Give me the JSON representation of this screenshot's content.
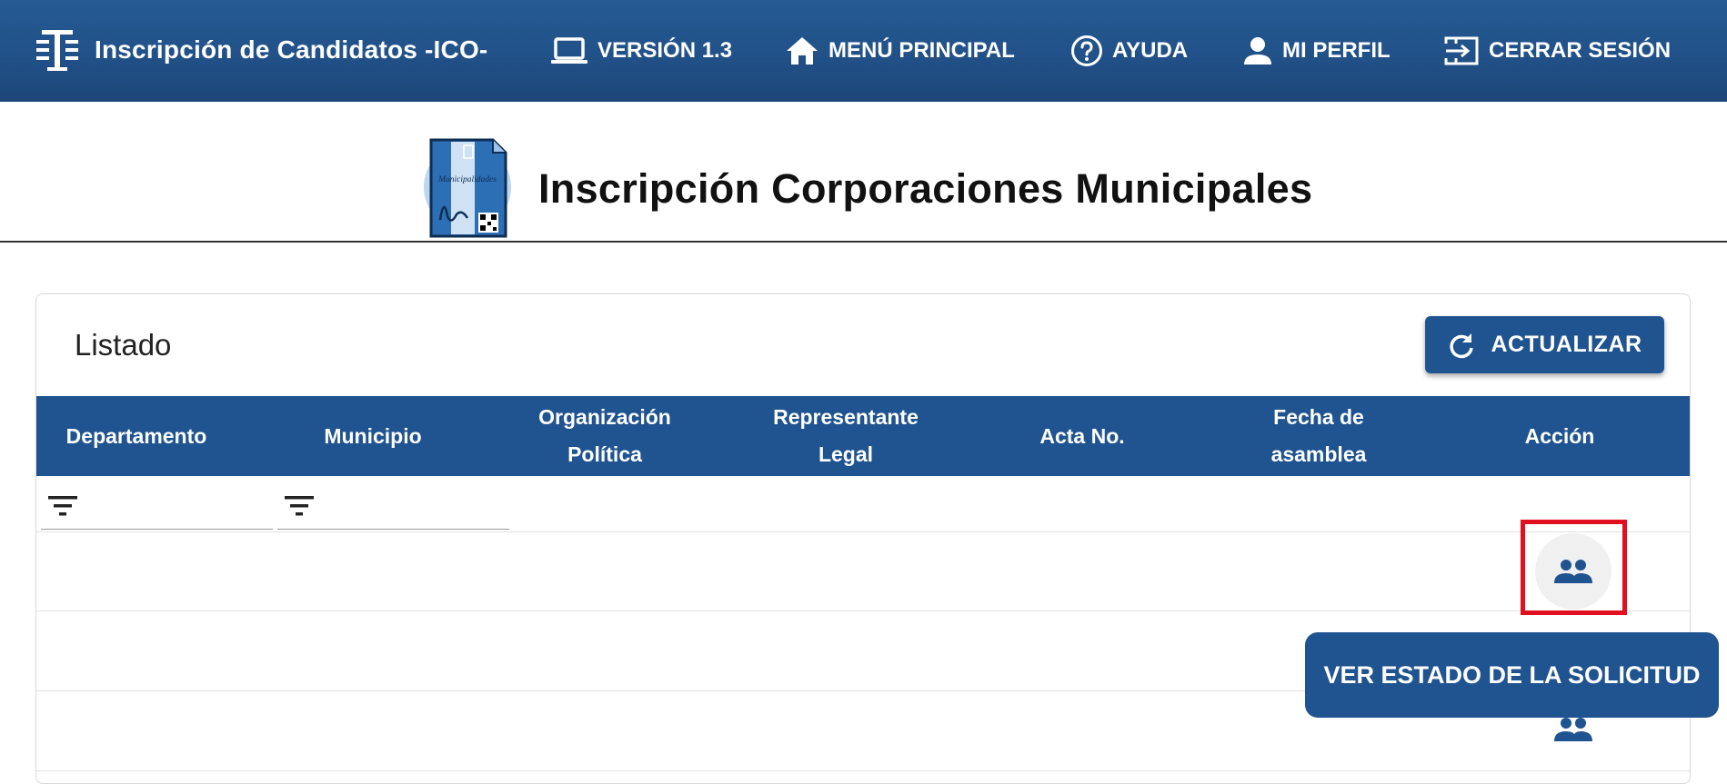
{
  "header": {
    "app_title": "Inscripción de Candidatos -ICO-",
    "nav": [
      {
        "label": "VERSIÓN 1.3",
        "icon": "laptop-icon"
      },
      {
        "label": "MENÚ PRINCIPAL",
        "icon": "home-icon"
      },
      {
        "label": "AYUDA",
        "icon": "help-circle-icon"
      },
      {
        "label": "MI PERFIL",
        "icon": "person-icon"
      },
      {
        "label": "CERRAR SESIÓN",
        "icon": "logout-icon"
      }
    ]
  },
  "page": {
    "title": "Inscripción Corporaciones Municipales",
    "logo_text": "Municipalidades"
  },
  "card": {
    "title": "Listado",
    "refresh_label": "ACTUALIZAR"
  },
  "table": {
    "columns": [
      "Departamento",
      "Municipio",
      "Organización Política",
      "Representante Legal",
      "Acta No.",
      "Fecha de asamblea",
      "Acción"
    ],
    "filters": [
      "filter-icon",
      "filter-icon"
    ],
    "rows": [
      {
        "action_icon": "group-icon"
      },
      {
        "action_icon": "group-icon"
      },
      {
        "action_icon": "group-icon"
      }
    ]
  },
  "tooltip": {
    "text": "VER ESTADO DE LA SOLICITUD"
  },
  "colors": {
    "primary": "#205490",
    "highlight": "#e01020"
  }
}
